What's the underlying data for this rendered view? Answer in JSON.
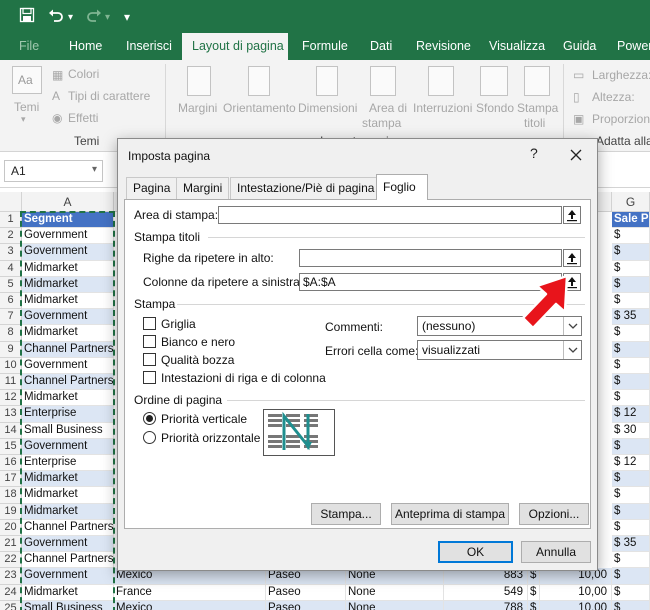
{
  "titlebar": {
    "bg": "#217346",
    "qat_more": "▾"
  },
  "tabs": [
    {
      "label": "File"
    },
    {
      "label": "Home"
    },
    {
      "label": "Inserisci"
    },
    {
      "label": "Layout di pagina"
    },
    {
      "label": "Formule"
    },
    {
      "label": "Dati"
    },
    {
      "label": "Revisione"
    },
    {
      "label": "Visualizza"
    },
    {
      "label": "Guida"
    },
    {
      "label": "Power"
    }
  ],
  "ribbon": {
    "temi": "Temi",
    "colori": "Colori",
    "tipi_carattere": "Tipi di carattere",
    "effetti": "Effetti",
    "group_temi": "Temi",
    "margini": "Margini",
    "orientamento": "Orientamento",
    "dimensioni": "Dimensioni",
    "area_stampa_1": "Area di",
    "area_stampa_2": "stampa",
    "interruzioni": "Interruzioni",
    "sfondo": "Sfondo",
    "stampa_titoli_1": "Stampa",
    "stampa_titoli_2": "titoli",
    "group_imposta": "Imposta pagina",
    "larghezza": "Larghezza:",
    "altezza": "Altezza:",
    "proporzioni": "Proporzion",
    "group_adatta": "Adatta alla"
  },
  "formula": {
    "namebox": "A1"
  },
  "sheet": {
    "cols": [
      "A",
      "G"
    ],
    "hdr_segment": "Segment",
    "hdr_sale": "Sale Pric",
    "row_numbers": [
      "1",
      "2",
      "3",
      "4",
      "5",
      "6",
      "7",
      "8",
      "9",
      "10",
      "11",
      "12",
      "13",
      "14",
      "15",
      "16",
      "17",
      "18",
      "19",
      "20",
      "21",
      "22",
      "23",
      "24",
      "25"
    ],
    "segments": [
      "Government",
      "Government",
      "Midmarket",
      "Midmarket",
      "Midmarket",
      "Government",
      "Midmarket",
      "Channel Partners",
      "Government",
      "Channel Partners",
      "Midmarket",
      "Enterprise",
      "Small Business",
      "Government",
      "Enterprise",
      "Midmarket",
      "Midmarket",
      "Midmarket",
      "Channel Partners",
      "Government",
      "Channel Partners",
      "Government",
      "Midmarket",
      "Small Business"
    ],
    "g_values": [
      "$",
      "$",
      "$",
      "$",
      "$",
      "$ 35",
      "$",
      "$",
      "$",
      "$",
      "$",
      "$ 12",
      "$ 30",
      "$",
      "$ 12",
      "$",
      "$",
      "$",
      "$",
      "$ 35",
      "$",
      "$",
      "$",
      "$"
    ],
    "bottom_rows": [
      {
        "country": "Mexico",
        "product": "Paseo",
        "discount": "None",
        "units": "883",
        "cur": "$",
        "price": "10,00",
        "g": "$"
      },
      {
        "country": "France",
        "product": "Paseo",
        "discount": "None",
        "units": "549",
        "cur": "$",
        "price": "10,00",
        "g": "$"
      },
      {
        "country": "Mexico",
        "product": "Paseo",
        "discount": "None",
        "units": "788",
        "cur": "$",
        "price": "10,00",
        "g": "$"
      }
    ]
  },
  "dialog": {
    "title": "Imposta pagina",
    "help": "?",
    "tabs": [
      "Pagina",
      "Margini",
      "Intestazione/Piè di pagina",
      "Foglio"
    ],
    "area_stampa_label": "Area di stampa:",
    "area_stampa_value": "",
    "stampa_titoli": "Stampa titoli",
    "righe_label": "Righe da ripetere in alto:",
    "righe_value": "",
    "colonne_label": "Colonne da ripetere a sinistra:",
    "colonne_value": "$A:$A",
    "stampa": "Stampa",
    "griglia": "Griglia",
    "bianco_nero": "Bianco e nero",
    "qualita_bozza": "Qualità bozza",
    "intestazioni": "Intestazioni di riga e di colonna",
    "commenti_label": "Commenti:",
    "commenti_value": "(nessuno)",
    "errori_label": "Errori cella come:",
    "errori_value": "visualizzati",
    "ordine": "Ordine di pagina",
    "priorita_verticale": "Priorità verticale",
    "priorita_orizzontale": "Priorità orizzontale",
    "btn_stampa": "Stampa...",
    "btn_anteprima": "Anteprima di stampa",
    "btn_opzioni": "Opzioni...",
    "btn_ok": "OK",
    "btn_annulla": "Annulla"
  },
  "colors": {
    "accent": "#217346",
    "table_header": "#4472c4",
    "band": "#dce6f4",
    "pointer": "#e8141b"
  }
}
